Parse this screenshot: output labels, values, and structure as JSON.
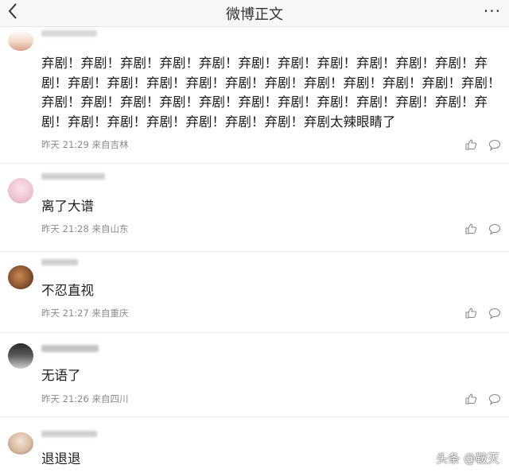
{
  "header": {
    "back_icon": "chevron-left-icon",
    "title": "微博正文",
    "more_label": "···"
  },
  "comments": [
    {
      "text": "弃剧！弃剧！弃剧！弃剧！弃剧！弃剧！弃剧！弃剧！弃剧！弃剧！弃剧！弃剧！弃剧！弃剧！弃剧！弃剧！弃剧！弃剧！弃剧！弃剧！弃剧！弃剧！弃剧！弃剧！弃剧！弃剧！弃剧！弃剧！弃剧！弃剧！弃剧！弃剧！弃剧！弃剧！弃剧！弃剧！弃剧！弃剧！弃剧！弃剧！弃剧！弃剧太辣眼睛了",
      "meta": "昨天 21:29 来自吉林"
    },
    {
      "text": "离了大谱",
      "meta": "昨天 21:28 来自山东"
    },
    {
      "text": "不忍直视",
      "meta": "昨天 21:27 来自重庆"
    },
    {
      "text": "无语了",
      "meta": "昨天 21:26 来自四川"
    },
    {
      "text": "退退退",
      "meta": ""
    }
  ],
  "icons": {
    "like": "thumbs-up-icon",
    "reply": "comment-bubble-icon"
  },
  "watermark": "头条 @鞍灭"
}
